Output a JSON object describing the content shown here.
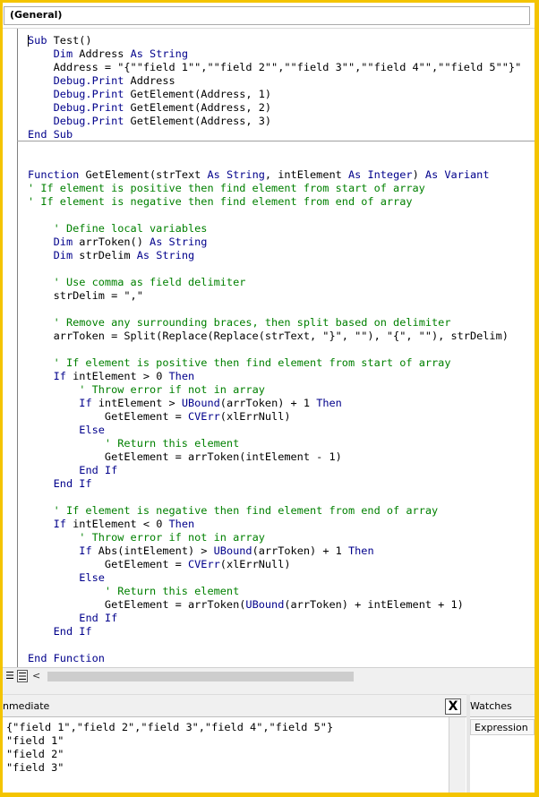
{
  "header": {
    "object_dropdown": "(General)"
  },
  "code": {
    "lines": [
      [
        {
          "t": "Sub",
          "c": "kw"
        },
        {
          "t": " Test()"
        }
      ],
      [
        {
          "t": "    "
        },
        {
          "t": "Dim",
          "c": "kw"
        },
        {
          "t": " Address "
        },
        {
          "t": "As String",
          "c": "kw"
        }
      ],
      [
        {
          "t": "    Address = \"{\"\"field 1\"\",\"\"field 2\"\",\"\"field 3\"\",\"\"field 4\"\",\"\"field 5\"\"}\""
        }
      ],
      [
        {
          "t": "    "
        },
        {
          "t": "Debug.Print",
          "c": "kw"
        },
        {
          "t": " Address"
        }
      ],
      [
        {
          "t": "    "
        },
        {
          "t": "Debug.Print",
          "c": "kw"
        },
        {
          "t": " GetElement(Address, 1)"
        }
      ],
      [
        {
          "t": "    "
        },
        {
          "t": "Debug.Print",
          "c": "kw"
        },
        {
          "t": " GetElement(Address, 2)"
        }
      ],
      [
        {
          "t": "    "
        },
        {
          "t": "Debug.Print",
          "c": "kw"
        },
        {
          "t": " GetElement(Address, 3)"
        }
      ],
      [
        {
          "t": "End Sub",
          "c": "kw"
        }
      ],
      [],
      [],
      [
        {
          "t": "Function",
          "c": "kw"
        },
        {
          "t": " GetElement(strText "
        },
        {
          "t": "As String",
          "c": "kw"
        },
        {
          "t": ", intElement "
        },
        {
          "t": "As Integer",
          "c": "kw"
        },
        {
          "t": ") "
        },
        {
          "t": "As Variant",
          "c": "kw"
        }
      ],
      [
        {
          "t": "' If element is positive then find element from start of array",
          "c": "cm"
        }
      ],
      [
        {
          "t": "' If element is negative then find element from end of array",
          "c": "cm"
        }
      ],
      [],
      [
        {
          "t": "    "
        },
        {
          "t": "' Define local variables",
          "c": "cm"
        }
      ],
      [
        {
          "t": "    "
        },
        {
          "t": "Dim",
          "c": "kw"
        },
        {
          "t": " arrToken() "
        },
        {
          "t": "As String",
          "c": "kw"
        }
      ],
      [
        {
          "t": "    "
        },
        {
          "t": "Dim",
          "c": "kw"
        },
        {
          "t": " strDelim "
        },
        {
          "t": "As String",
          "c": "kw"
        }
      ],
      [],
      [
        {
          "t": "    "
        },
        {
          "t": "' Use comma as field delimiter",
          "c": "cm"
        }
      ],
      [
        {
          "t": "    strDelim = \",\""
        }
      ],
      [],
      [
        {
          "t": "    "
        },
        {
          "t": "' Remove any surrounding braces, then split based on delimiter",
          "c": "cm"
        }
      ],
      [
        {
          "t": "    arrToken = Split(Replace(Replace(strText, \"}\", \"\"), \"{\", \"\"), strDelim)"
        }
      ],
      [],
      [
        {
          "t": "    "
        },
        {
          "t": "' If element is positive then find element from start of array",
          "c": "cm"
        }
      ],
      [
        {
          "t": "    "
        },
        {
          "t": "If",
          "c": "kw"
        },
        {
          "t": " intElement > 0 "
        },
        {
          "t": "Then",
          "c": "kw"
        }
      ],
      [
        {
          "t": "        "
        },
        {
          "t": "' Throw error if not in array",
          "c": "cm"
        }
      ],
      [
        {
          "t": "        "
        },
        {
          "t": "If",
          "c": "kw"
        },
        {
          "t": " intElement > "
        },
        {
          "t": "UBound",
          "c": "kw"
        },
        {
          "t": "(arrToken) + 1 "
        },
        {
          "t": "Then",
          "c": "kw"
        }
      ],
      [
        {
          "t": "            GetElement = "
        },
        {
          "t": "CVErr",
          "c": "kw"
        },
        {
          "t": "(xlErrNull)"
        }
      ],
      [
        {
          "t": "        "
        },
        {
          "t": "Else",
          "c": "kw"
        }
      ],
      [
        {
          "t": "            "
        },
        {
          "t": "' Return this element",
          "c": "cm"
        }
      ],
      [
        {
          "t": "            GetElement = arrToken(intElement - 1)"
        }
      ],
      [
        {
          "t": "        "
        },
        {
          "t": "End If",
          "c": "kw"
        }
      ],
      [
        {
          "t": "    "
        },
        {
          "t": "End If",
          "c": "kw"
        }
      ],
      [],
      [
        {
          "t": "    "
        },
        {
          "t": "' If element is negative then find element from end of array",
          "c": "cm"
        }
      ],
      [
        {
          "t": "    "
        },
        {
          "t": "If",
          "c": "kw"
        },
        {
          "t": " intElement < 0 "
        },
        {
          "t": "Then",
          "c": "kw"
        }
      ],
      [
        {
          "t": "        "
        },
        {
          "t": "' Throw error if not in array",
          "c": "cm"
        }
      ],
      [
        {
          "t": "        "
        },
        {
          "t": "If",
          "c": "kw"
        },
        {
          "t": " Abs(intElement) > "
        },
        {
          "t": "UBound",
          "c": "kw"
        },
        {
          "t": "(arrToken) + 1 "
        },
        {
          "t": "Then",
          "c": "kw"
        }
      ],
      [
        {
          "t": "            GetElement = "
        },
        {
          "t": "CVErr",
          "c": "kw"
        },
        {
          "t": "(xlErrNull)"
        }
      ],
      [
        {
          "t": "        "
        },
        {
          "t": "Else",
          "c": "kw"
        }
      ],
      [
        {
          "t": "            "
        },
        {
          "t": "' Return this element",
          "c": "cm"
        }
      ],
      [
        {
          "t": "            GetElement = arrToken("
        },
        {
          "t": "UBound",
          "c": "kw"
        },
        {
          "t": "(arrToken) + intElement + 1)"
        }
      ],
      [
        {
          "t": "        "
        },
        {
          "t": "End If",
          "c": "kw"
        }
      ],
      [
        {
          "t": "    "
        },
        {
          "t": "End If",
          "c": "kw"
        }
      ],
      [],
      [
        {
          "t": "End Function",
          "c": "kw"
        }
      ]
    ]
  },
  "code_pane_bar": {
    "scroll_left": "<"
  },
  "immediate": {
    "title": "nmediate",
    "close_label": "X",
    "lines": [
      "{\"field 1\",\"field 2\",\"field 3\",\"field 4\",\"field 5\"}",
      "\"field 1\"",
      "\"field 2\"",
      "\"field 3\""
    ]
  },
  "watches": {
    "title": "Watches",
    "column_header": "Expression"
  },
  "colors": {
    "keyword": "#00008b",
    "comment": "#008000",
    "frame": "#f4c400"
  }
}
